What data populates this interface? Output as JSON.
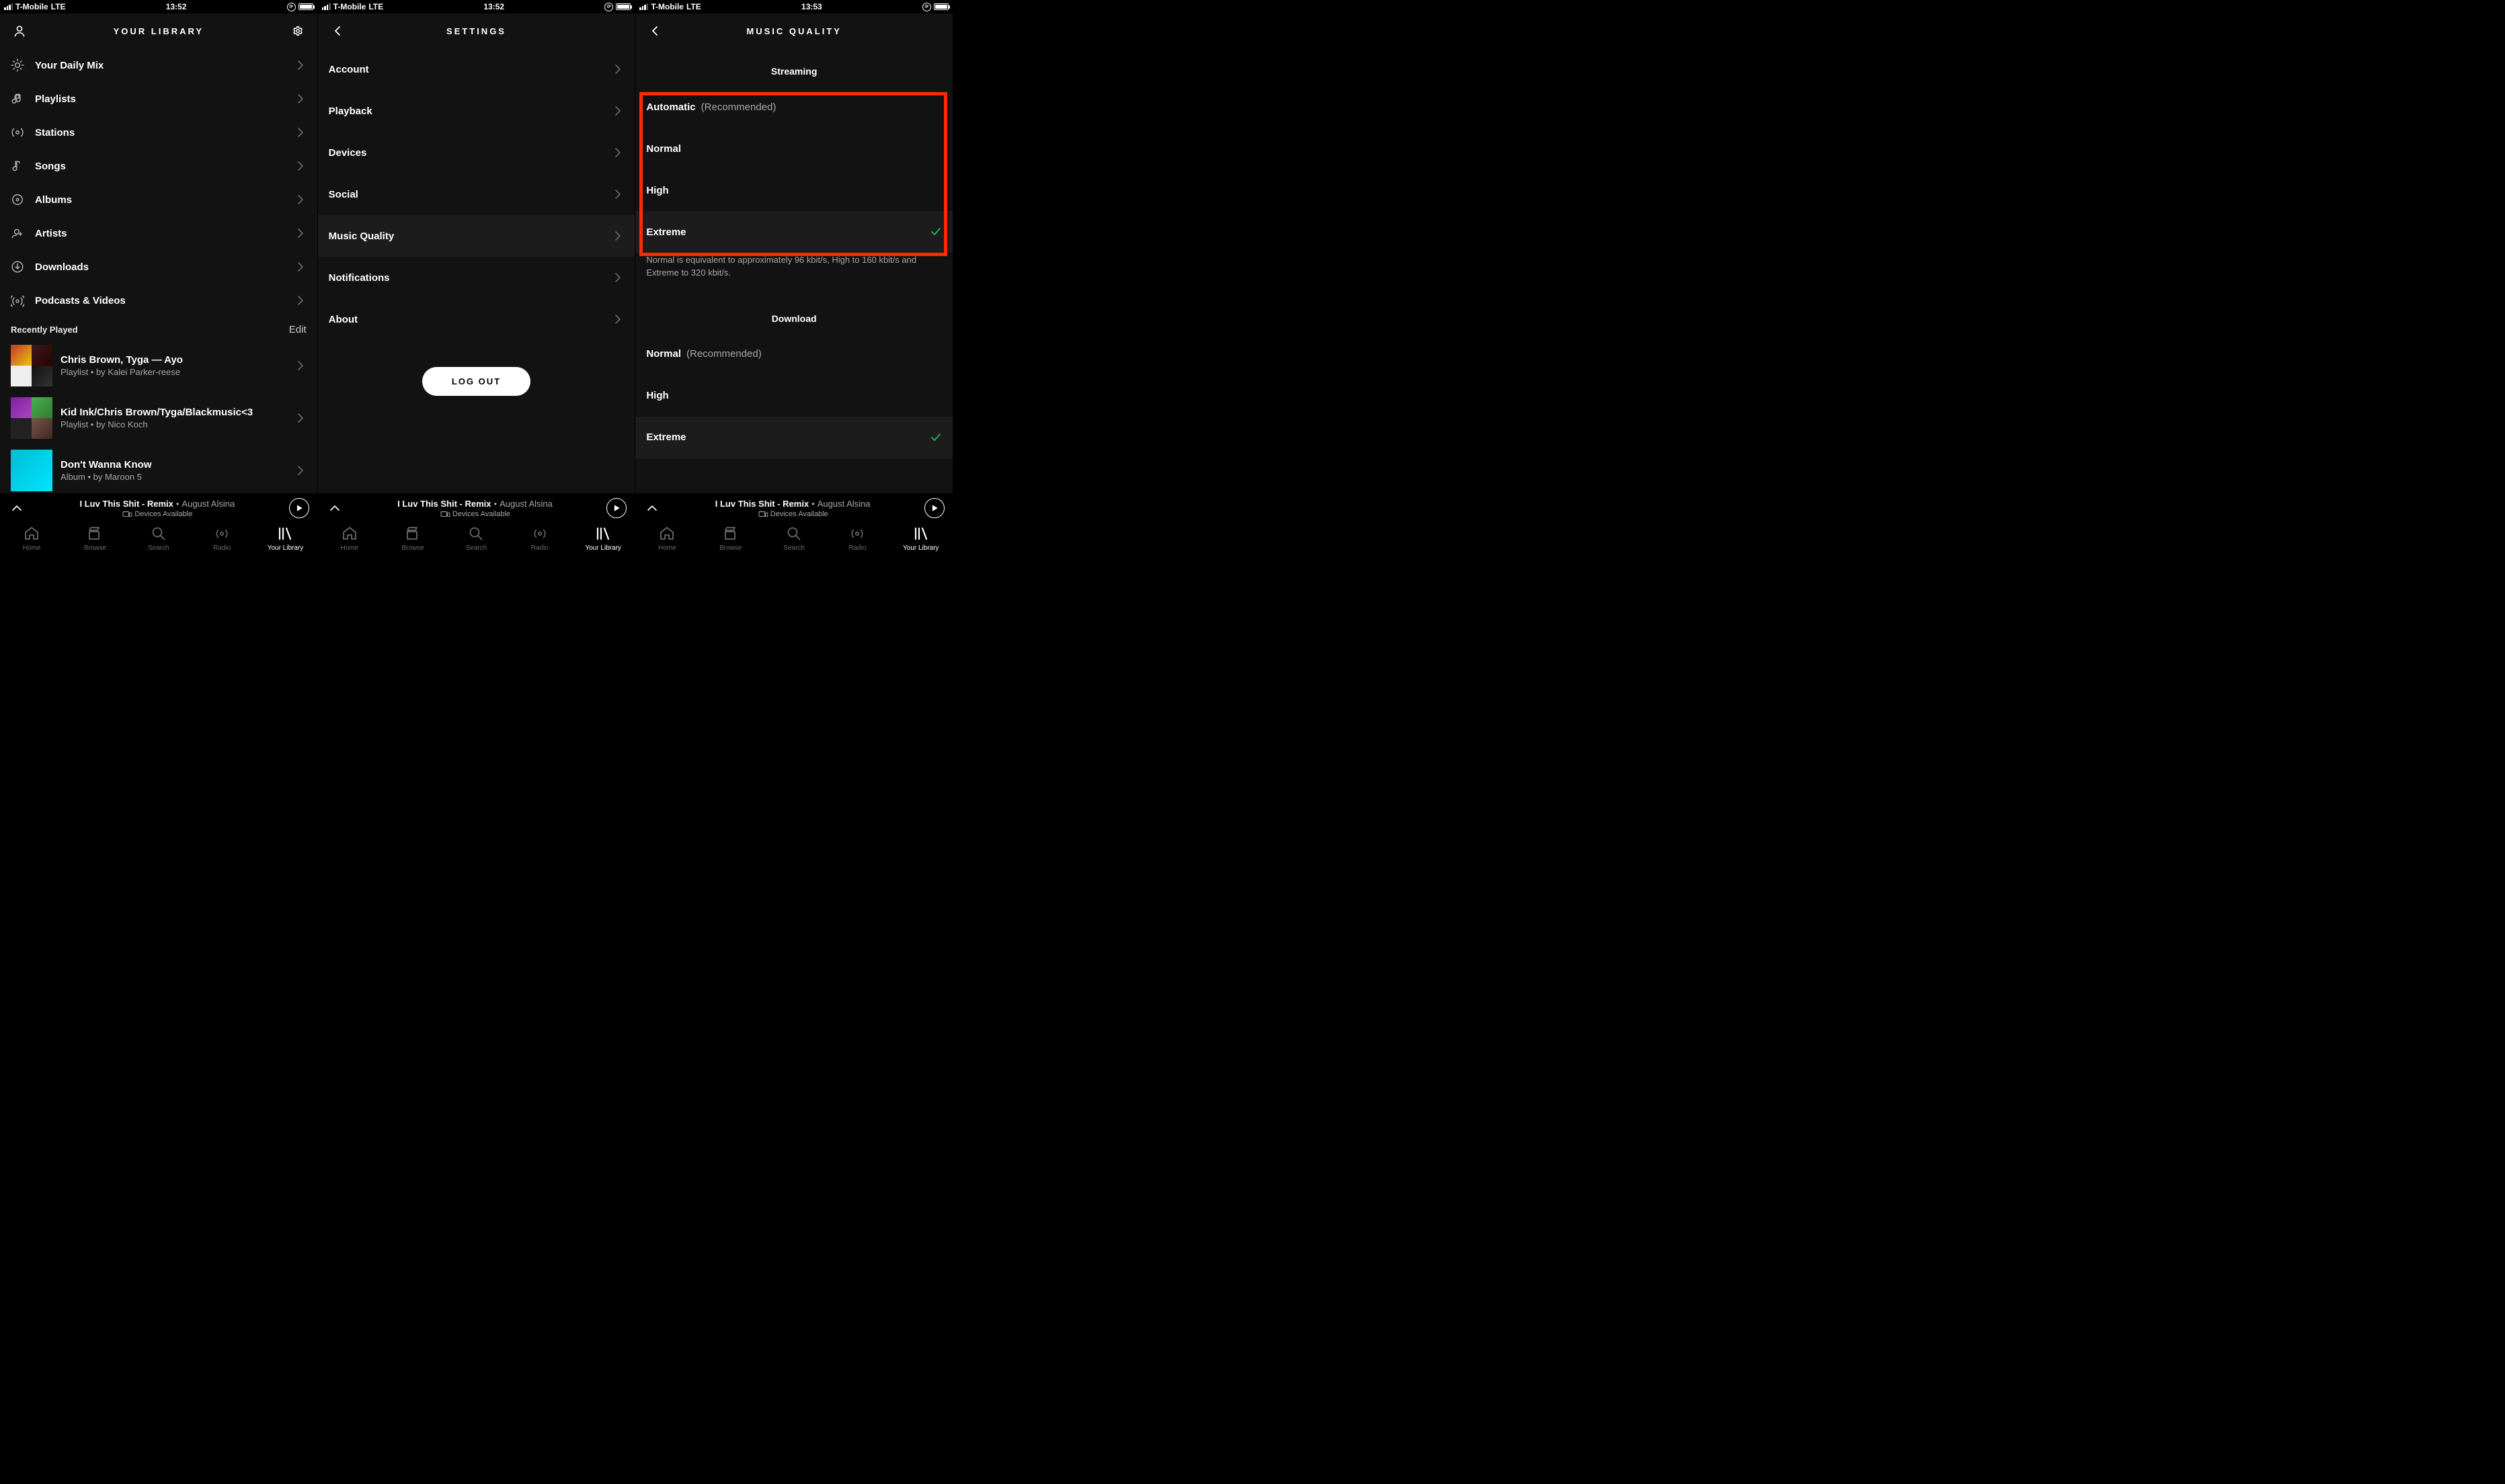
{
  "status": {
    "carrier": "T-Mobile",
    "network": "LTE"
  },
  "times": {
    "s1": "13:52",
    "s2": "13:52",
    "s3": "13:53"
  },
  "screen1": {
    "title": "YOUR LIBRARY",
    "items": [
      {
        "label": "Your Daily Mix",
        "icon": "sun-icon"
      },
      {
        "label": "Playlists",
        "icon": "music-note-icon"
      },
      {
        "label": "Stations",
        "icon": "radio-wave-icon"
      },
      {
        "label": "Songs",
        "icon": "song-note-icon"
      },
      {
        "label": "Albums",
        "icon": "disc-icon"
      },
      {
        "label": "Artists",
        "icon": "person-add-icon"
      },
      {
        "label": "Downloads",
        "icon": "download-icon"
      },
      {
        "label": "Podcasts & Videos",
        "icon": "broadcast-icon"
      }
    ],
    "recently": {
      "title": "Recently Played",
      "edit": "Edit",
      "items": [
        {
          "title": "Chris Brown, Tyga — Ayo",
          "sub": "Playlist • by Kalei Parker-reese"
        },
        {
          "title": "Kid Ink/Chris Brown/Tyga/Blackmusic<3",
          "sub": "Playlist • by Nico Koch"
        },
        {
          "title": "Don't Wanna Know",
          "sub": "Album • by Maroon 5"
        }
      ]
    }
  },
  "screen2": {
    "title": "SETTINGS",
    "items": [
      {
        "label": "Account"
      },
      {
        "label": "Playback"
      },
      {
        "label": "Devices"
      },
      {
        "label": "Social"
      },
      {
        "label": "Music Quality",
        "highlighted": true
      },
      {
        "label": "Notifications"
      },
      {
        "label": "About"
      }
    ],
    "logout": "LOG OUT"
  },
  "screen3": {
    "title": "MUSIC QUALITY",
    "streaming": {
      "heading": "Streaming",
      "items": [
        {
          "label": "Automatic",
          "secondary": "(Recommended)"
        },
        {
          "label": "Normal"
        },
        {
          "label": "High"
        },
        {
          "label": "Extreme",
          "selected": true
        }
      ],
      "helper": "Normal is equivalent to approximately 96 kbit/s, High to 160 kbit/s and Extreme to 320 kbit/s."
    },
    "download": {
      "heading": "Download",
      "items": [
        {
          "label": "Normal",
          "secondary": "(Recommended)"
        },
        {
          "label": "High"
        },
        {
          "label": "Extreme",
          "selected": true
        }
      ]
    }
  },
  "nowplaying": {
    "song": "I Luv This Shit - Remix",
    "artist": "August Alsina",
    "devices": "Devices Available"
  },
  "tabs": [
    {
      "label": "Home",
      "icon": "home-icon"
    },
    {
      "label": "Browse",
      "icon": "browse-icon"
    },
    {
      "label": "Search",
      "icon": "search-icon"
    },
    {
      "label": "Radio",
      "icon": "radio-icon"
    },
    {
      "label": "Your Library",
      "icon": "library-icon",
      "active": true
    }
  ]
}
